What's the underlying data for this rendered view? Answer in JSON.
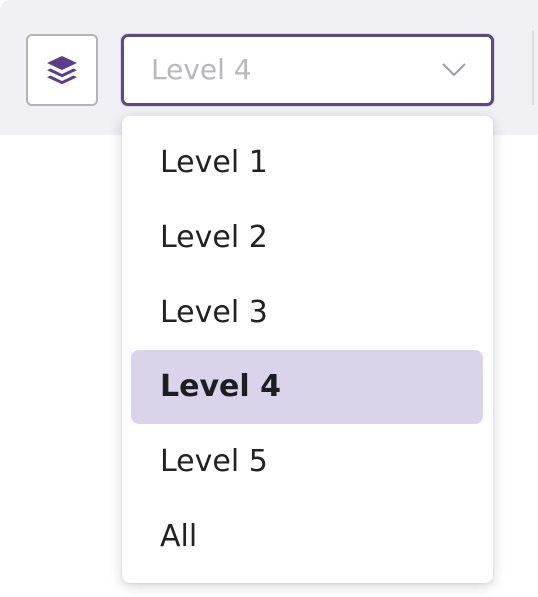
{
  "toolbar": {
    "layers_button_icon": "layers-icon"
  },
  "level_select": {
    "value": "Level 4",
    "chevron_icon": "chevron-down-icon"
  },
  "dropdown": {
    "options": [
      {
        "label": "Level 1",
        "selected": false
      },
      {
        "label": "Level 2",
        "selected": false
      },
      {
        "label": "Level 3",
        "selected": false
      },
      {
        "label": "Level 4",
        "selected": true
      },
      {
        "label": "Level 5",
        "selected": false
      },
      {
        "label": "All",
        "selected": false
      }
    ]
  },
  "colors": {
    "accent": "#5b4a86",
    "selected_bg": "#dad3ea",
    "icon": "#5a3e8c",
    "toolbar_bg": "#f1f0f5"
  }
}
